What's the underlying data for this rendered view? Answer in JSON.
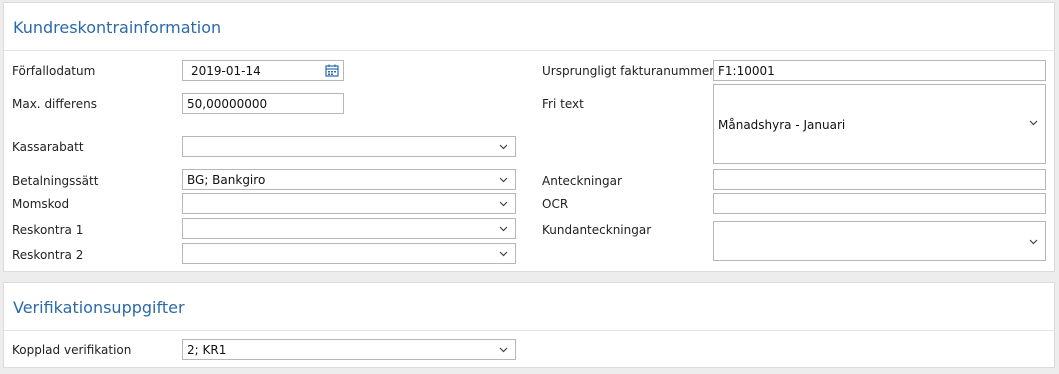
{
  "section1": {
    "title": "Kundreskontrainformation",
    "left": {
      "due_date": {
        "label": "Förfallodatum",
        "value": "2019-01-14",
        "icon": "calendar-icon"
      },
      "max_diff": {
        "label": "Max. differens",
        "value": "50,00000000"
      },
      "cash_discount": {
        "label": "Kassarabatt",
        "value": ""
      },
      "payment_method": {
        "label": "Betalningssätt",
        "value": "BG; Bankgiro"
      },
      "vat_code": {
        "label": "Momskod",
        "value": ""
      },
      "ledger1": {
        "label": "Reskontra 1",
        "value": ""
      },
      "ledger2": {
        "label": "Reskontra 2",
        "value": ""
      }
    },
    "right": {
      "orig_invoice": {
        "label": "Ursprungligt fakturanummer",
        "value": "F1:10001"
      },
      "free_text": {
        "label": "Fri text",
        "value": "Månadshyra - Januari"
      },
      "notes": {
        "label": "Anteckningar",
        "value": ""
      },
      "ocr": {
        "label": "OCR",
        "value": ""
      },
      "customer_notes": {
        "label": "Kundanteckningar",
        "value": ""
      }
    }
  },
  "section2": {
    "title": "Verifikationsuppgifter",
    "linked_voucher": {
      "label": "Kopplad verifikation",
      "value": "2; KR1"
    }
  },
  "colors": {
    "title": "#2b6aa8",
    "border": "#b7b7b7",
    "background": "#ededed",
    "calendar_icon": "#2b6aa8"
  }
}
